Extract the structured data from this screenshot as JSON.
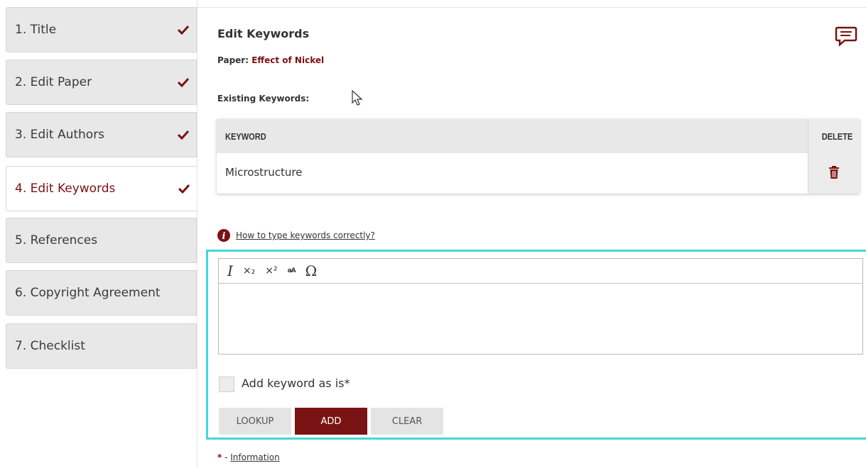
{
  "sidebar": {
    "steps": [
      {
        "label": "1. Title",
        "done": true
      },
      {
        "label": "2. Edit Paper",
        "done": true
      },
      {
        "label": "3. Edit Authors",
        "done": true
      },
      {
        "label": "4. Edit Keywords",
        "done": true,
        "active": true
      },
      {
        "label": "5. References",
        "done": false
      },
      {
        "label": "6. Copyright Agreement",
        "done": false
      },
      {
        "label": "7. Checklist",
        "done": false
      }
    ]
  },
  "main": {
    "heading": "Edit Keywords",
    "paper_prefix": "Paper:",
    "paper_title": "Effect of Nickel",
    "existing_label": "Existing Keywords:",
    "table": {
      "col_keyword": "KEYWORD",
      "col_delete": "DELETE",
      "rows": [
        {
          "keyword": "Microstructure"
        }
      ]
    },
    "help_link": "How to type keywords correctly?",
    "editor": {
      "toolbar": {
        "italic": "I",
        "subscript": "×₂",
        "superscript": "×²",
        "smallcaps": "aA",
        "omega": "Ω"
      },
      "value": ""
    },
    "checkbox_label": "Add keyword as is*",
    "buttons": {
      "lookup": "LOOKUP",
      "add": "ADD",
      "clear": "CLEAR"
    },
    "footnote": {
      "star": "*",
      "sep": " - ",
      "link": "Information"
    }
  },
  "colors": {
    "accent": "#7a1212",
    "highlight": "#44d7db",
    "panel": "#e8e8e8"
  },
  "icons": {
    "check": "checkmark-icon",
    "comment": "comment-icon",
    "trash": "trash-icon",
    "info": "info-icon",
    "cursor": "mouse-cursor-icon"
  }
}
